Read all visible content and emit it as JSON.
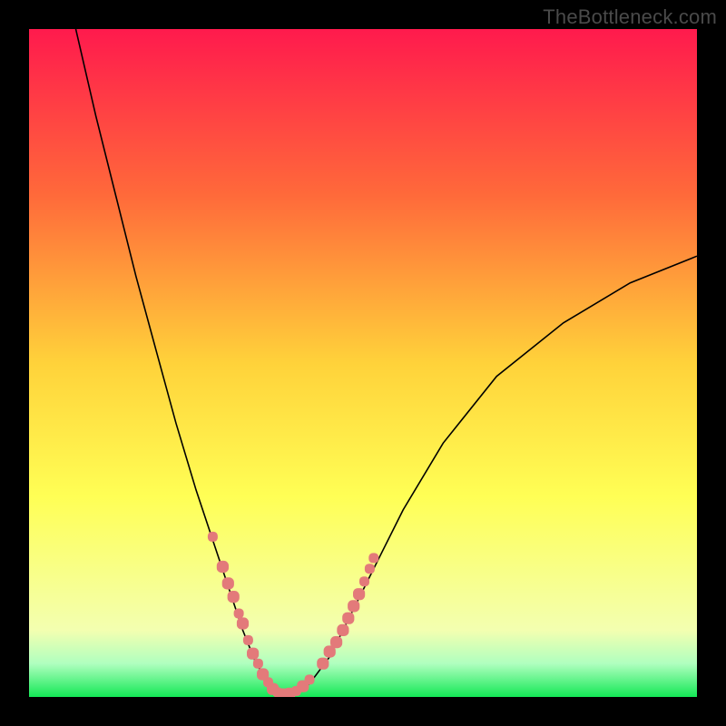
{
  "watermark": "TheBottleneck.com",
  "gradient": {
    "stops": [
      {
        "offset": 0.0,
        "color": "#ff1a4d"
      },
      {
        "offset": 0.25,
        "color": "#ff6a3a"
      },
      {
        "offset": 0.5,
        "color": "#ffd23a"
      },
      {
        "offset": 0.7,
        "color": "#ffff55"
      },
      {
        "offset": 0.9,
        "color": "#f3ffb0"
      },
      {
        "offset": 0.95,
        "color": "#b0ffbf"
      },
      {
        "offset": 1.0,
        "color": "#14e856"
      }
    ]
  },
  "chart_data": {
    "type": "line",
    "title": "",
    "xlabel": "",
    "ylabel": "",
    "xlim": [
      0,
      100
    ],
    "ylim": [
      0,
      100
    ],
    "series": [
      {
        "name": "bottleneck-curve",
        "x": [
          7,
          10,
          13,
          16,
          19,
          22,
          25,
          28,
          30,
          32,
          34,
          36,
          37,
          38,
          40,
          42,
          45,
          48,
          52,
          56,
          62,
          70,
          80,
          90,
          100
        ],
        "y": [
          100,
          87,
          75,
          63,
          52,
          41,
          31,
          22,
          16,
          10,
          5,
          2,
          0.6,
          0.4,
          0.6,
          2,
          6,
          12,
          20,
          28,
          38,
          48,
          56,
          62,
          66
        ]
      }
    ],
    "highlight_clusters": [
      {
        "name": "left-cluster",
        "x_range": [
          27,
          38
        ],
        "y_range": [
          0,
          25
        ]
      },
      {
        "name": "right-cluster",
        "x_range": [
          38,
          50
        ],
        "y_range": [
          0,
          22
        ]
      }
    ],
    "highlight_points": [
      {
        "x": 27.5,
        "y": 24,
        "r": 5
      },
      {
        "x": 29.0,
        "y": 19.5,
        "r": 6
      },
      {
        "x": 29.8,
        "y": 17.0,
        "r": 6
      },
      {
        "x": 30.6,
        "y": 15.0,
        "r": 6
      },
      {
        "x": 31.4,
        "y": 12.5,
        "r": 5
      },
      {
        "x": 32.0,
        "y": 11.0,
        "r": 6
      },
      {
        "x": 32.8,
        "y": 8.5,
        "r": 5
      },
      {
        "x": 33.5,
        "y": 6.5,
        "r": 6
      },
      {
        "x": 34.3,
        "y": 5.0,
        "r": 5
      },
      {
        "x": 35.0,
        "y": 3.4,
        "r": 6
      },
      {
        "x": 35.8,
        "y": 2.2,
        "r": 5
      },
      {
        "x": 36.5,
        "y": 1.2,
        "r": 6
      },
      {
        "x": 37.2,
        "y": 0.7,
        "r": 5
      },
      {
        "x": 38.0,
        "y": 0.4,
        "r": 6
      },
      {
        "x": 39.0,
        "y": 0.5,
        "r": 6
      },
      {
        "x": 40.0,
        "y": 0.9,
        "r": 5
      },
      {
        "x": 41.0,
        "y": 1.6,
        "r": 6
      },
      {
        "x": 42.0,
        "y": 2.6,
        "r": 5
      },
      {
        "x": 44.0,
        "y": 5.0,
        "r": 6
      },
      {
        "x": 45.0,
        "y": 6.8,
        "r": 6
      },
      {
        "x": 46.0,
        "y": 8.2,
        "r": 6
      },
      {
        "x": 47.0,
        "y": 10.0,
        "r": 6
      },
      {
        "x": 47.8,
        "y": 11.8,
        "r": 6
      },
      {
        "x": 48.6,
        "y": 13.6,
        "r": 6
      },
      {
        "x": 49.4,
        "y": 15.4,
        "r": 6
      },
      {
        "x": 50.2,
        "y": 17.3,
        "r": 5
      },
      {
        "x": 51.0,
        "y": 19.2,
        "r": 5
      },
      {
        "x": 51.6,
        "y": 20.8,
        "r": 5
      }
    ]
  }
}
